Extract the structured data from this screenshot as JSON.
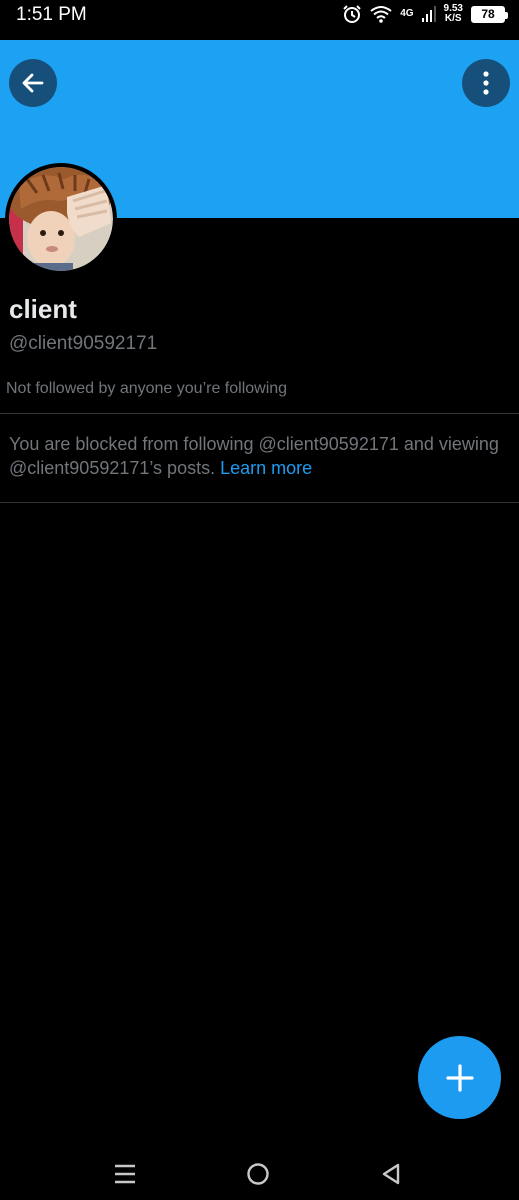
{
  "status_bar": {
    "time": "1:51 PM",
    "network": "4G",
    "speed_value": "9.53",
    "speed_unit": "K/S",
    "battery": "78"
  },
  "header": {
    "back_icon": "arrow-left-icon",
    "more_icon": "more-vertical-icon",
    "banner_color": "#1da1f2"
  },
  "profile": {
    "display_name": "client",
    "handle": "@client90592171",
    "followers_note": "Not followed by anyone you’re following",
    "blocked_message": "You are blocked from following @client90592171 and viewing @client90592171’s posts.",
    "learn_more": "Learn more"
  },
  "fab": {
    "icon": "plus-icon",
    "color": "#1d9bf0"
  },
  "nav_bar": {
    "recent_icon": "recent-apps-icon",
    "home_icon": "home-circle-icon",
    "back_icon": "back-triangle-icon"
  }
}
